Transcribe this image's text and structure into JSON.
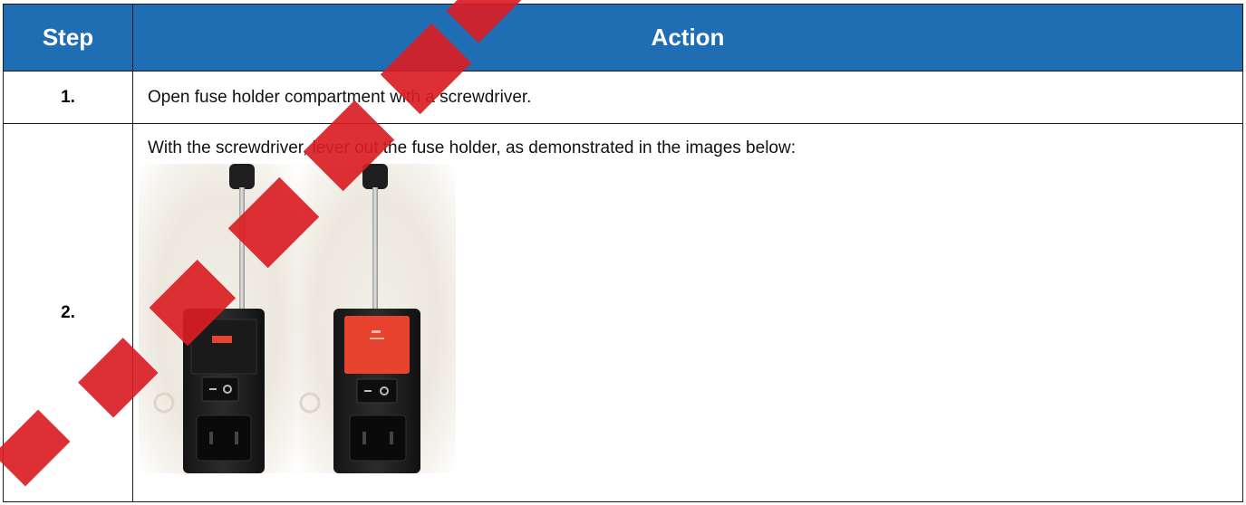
{
  "table": {
    "header": {
      "step": "Step",
      "action": "Action"
    },
    "rows": [
      {
        "step": "1.",
        "action": "Open fuse holder compartment with a screwdriver."
      },
      {
        "step": "2.",
        "action": "With the screwdriver, lever out the fuse holder, as demonstrated in the images below:"
      }
    ]
  },
  "colors": {
    "header_bg": "#1f6db3",
    "header_text": "#ffffff",
    "fuse_holder": "#e8432e",
    "watermark": "#d91e24"
  }
}
